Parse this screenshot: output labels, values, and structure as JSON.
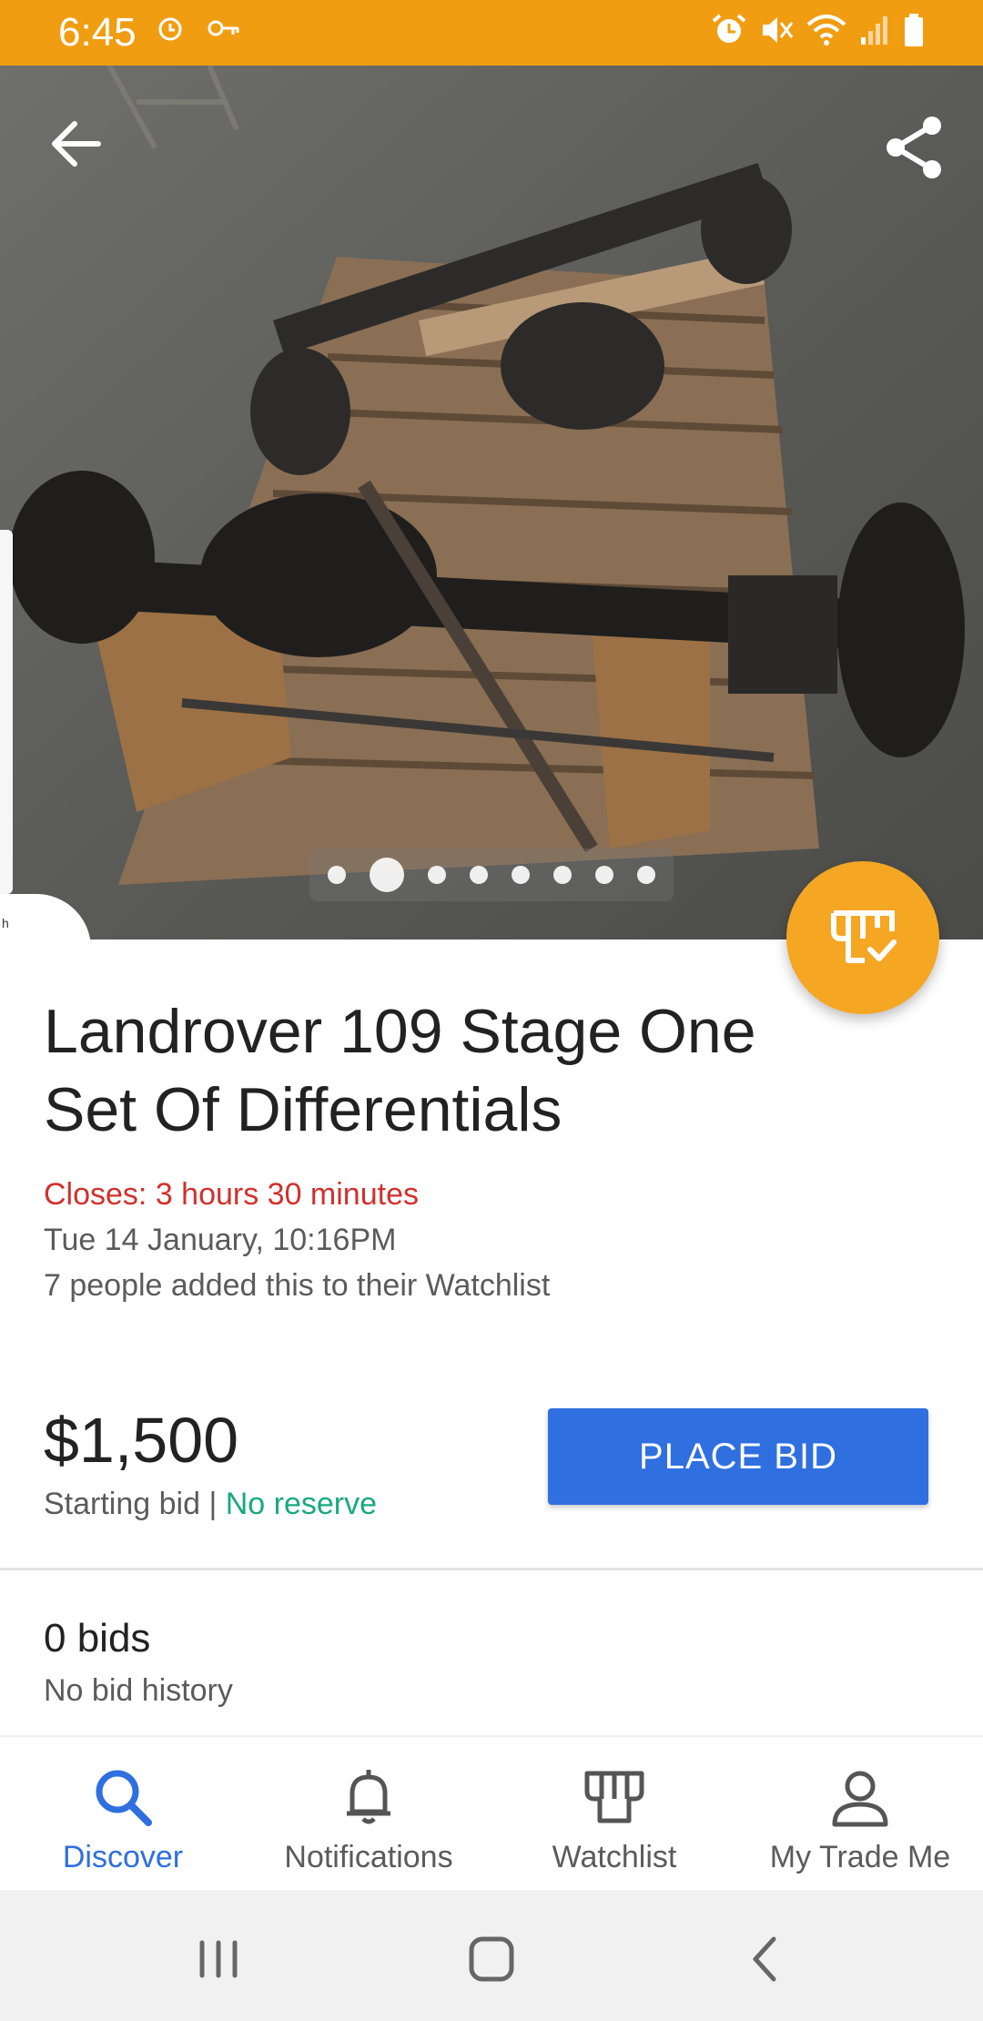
{
  "status_bar": {
    "time": "6:45",
    "icons_left": [
      "alarm-icon",
      "key-icon"
    ],
    "icons_right": [
      "alarm-icon",
      "mute-icon",
      "wifi-icon",
      "signal-icon",
      "battery-icon"
    ],
    "color": "#f19d12"
  },
  "hero": {
    "image_description_icon": "photo",
    "pager": {
      "count": 8,
      "active_index": 1
    }
  },
  "listing": {
    "title": "Landrover 109 Stage One Set Of Differentials",
    "closes": "Closes: 3 hours 30 minutes",
    "close_date": "Tue 14 January, 10:16PM",
    "watch_count_text": "7 people added this to their Watchlist"
  },
  "pricing": {
    "price": "$1,500",
    "starting_bid_label": "Starting bid",
    "separator": " | ",
    "reserve_label": "No reserve",
    "place_bid_label": "PLACE BID"
  },
  "bids": {
    "count_text": "0 bids",
    "history_text": "No bid history"
  },
  "bottom_nav": {
    "items": [
      {
        "label": "Discover",
        "icon": "search-icon",
        "active": true
      },
      {
        "label": "Notifications",
        "icon": "bell-icon",
        "active": false
      },
      {
        "label": "Watchlist",
        "icon": "watchlist-icon",
        "active": false
      },
      {
        "label": "My Trade Me",
        "icon": "person-icon",
        "active": false
      }
    ]
  },
  "colors": {
    "accent_blue": "#2f6fe0",
    "close_red": "#d0312d",
    "reserve_green": "#1aaa7a",
    "fab_orange": "#f5a623"
  }
}
